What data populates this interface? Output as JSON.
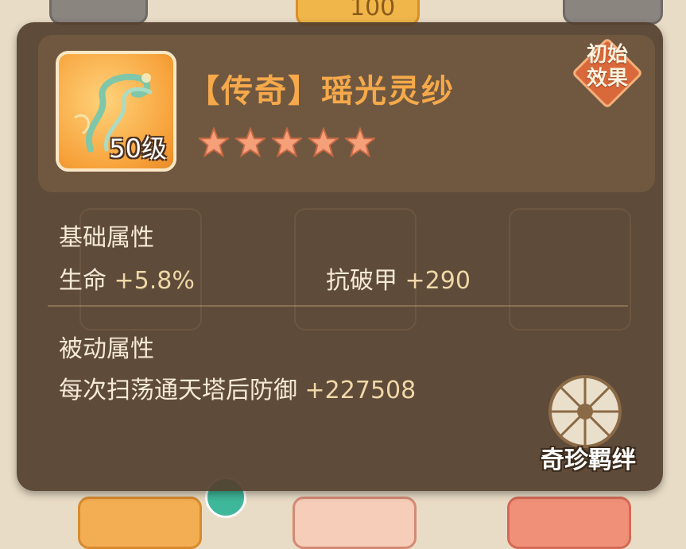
{
  "item": {
    "title": "【传奇】瑶光灵纱",
    "level": "50级",
    "stars": 5,
    "initial_effect_badge": "初始\n效果"
  },
  "base_attributes": {
    "label": "基础属性",
    "stats": [
      {
        "name": "生命",
        "value": "+5.8%"
      },
      {
        "name": "抗破甲",
        "value": "+290"
      }
    ]
  },
  "passive_attributes": {
    "label": "被动属性",
    "effect_text": "每次扫荡通天塔后防御",
    "effect_value": "+227508"
  },
  "bond_button": {
    "label": "奇珍羁绊"
  },
  "background": {
    "top_center_count": "100"
  },
  "colors": {
    "title": "#f6a94a",
    "popup_bg": "#54402e",
    "star": "#f6a07a",
    "badge": "#d9683a"
  }
}
